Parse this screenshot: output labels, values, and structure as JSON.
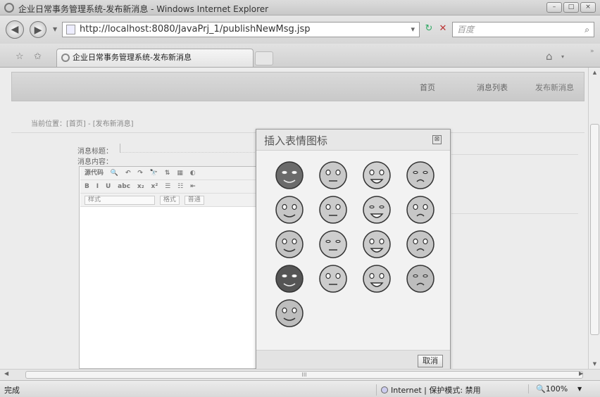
{
  "window": {
    "title": "企业日常事务管理系统-发布新消息 - Windows Internet Explorer",
    "min": "–",
    "max": "□",
    "close": "×"
  },
  "address": {
    "back": "◀",
    "forward": "▶",
    "nav_drop": "▼",
    "url": "http://localhost:8080/JavaPrj_1/publishNewMsg.jsp",
    "url_drop": "▾",
    "refresh": "↻",
    "stop": "✕",
    "search_placeholder": "百度",
    "search_go": "⌕"
  },
  "tabs": {
    "favorites": "☆",
    "add_favorites": "✩",
    "active_tab": "企业日常事务管理系统-发布新消息",
    "home": "⌂",
    "home_drop": "▾",
    "more": "»"
  },
  "page": {
    "nav": [
      "首页",
      "消息列表",
      "发布新消息"
    ],
    "breadcrumb": "当前位置：[首页] - [发布新消息]",
    "title_label": "消息标题：",
    "content_label": "消息内容：",
    "toolbar_row1": [
      "源代码",
      "🔍",
      "↶",
      "↷",
      "🔭",
      "⇅",
      "▦",
      "◐"
    ],
    "toolbar_row2": [
      "B",
      "I",
      "U",
      "abc",
      "x₂",
      "x²",
      "☰",
      "☷",
      "⇤"
    ],
    "style_select": "样式",
    "format_select": "格式",
    "format_value": "普通"
  },
  "dialog": {
    "title": "插入表情图标",
    "close": "⊠",
    "cancel": "取消",
    "emoticons": [
      {
        "name": "ninja",
        "color": "#6b6b6b"
      },
      {
        "name": "phone",
        "color": "#c9c9c9"
      },
      {
        "name": "wave",
        "color": "#cfcfcf"
      },
      {
        "name": "kiss",
        "color": "#c8c8c8"
      },
      {
        "name": "sleepy",
        "color": "#c6c6c6"
      },
      {
        "name": "wink",
        "color": "#cbcbcb"
      },
      {
        "name": "worried",
        "color": "#d0d0d0"
      },
      {
        "name": "thumbs-up",
        "color": "#c7c7c7"
      },
      {
        "name": "yawn",
        "color": "#c4c4c4"
      },
      {
        "name": "grin",
        "color": "#cecece"
      },
      {
        "name": "tongue",
        "color": "#cbcbcb"
      },
      {
        "name": "laugh",
        "color": "#c6c6c6"
      },
      {
        "name": "devil",
        "color": "#555555"
      },
      {
        "name": "shush",
        "color": "#cccccc"
      },
      {
        "name": "relieved",
        "color": "#cacaca"
      },
      {
        "name": "blank",
        "color": "#bdbdbd"
      },
      {
        "name": "shout",
        "color": "#bebebe"
      }
    ]
  },
  "hscroll_label": "III",
  "status": {
    "done": "完成",
    "zone": "Internet | 保护模式: 禁用",
    "zoom": "🔍100%",
    "zoom_drop": "▼"
  }
}
